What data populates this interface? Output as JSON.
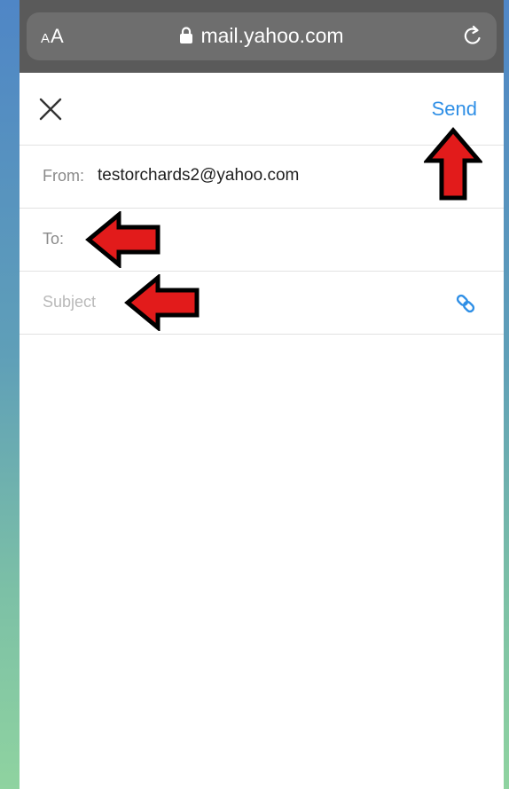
{
  "browser": {
    "text_size_label": "AA",
    "url": "mail.yahoo.com"
  },
  "compose": {
    "send_label": "Send",
    "from_label": "From:",
    "from_value": "testorchards2@yahoo.com",
    "to_label": "To:",
    "subject_placeholder": "Subject"
  },
  "colors": {
    "accent": "#2f8fe6",
    "annotation_arrow": "#e21b1b"
  },
  "icons": [
    "lock-icon",
    "reload-icon",
    "close-icon",
    "attachment-icon",
    "annotation-arrow"
  ]
}
